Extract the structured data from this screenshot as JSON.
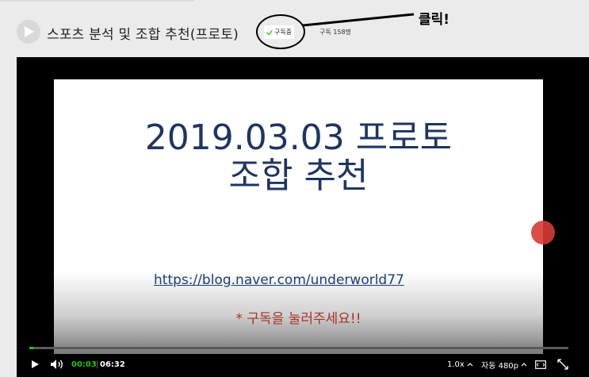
{
  "header": {
    "channel_title": "스포츠 분석 및 조합 추천(프로토)",
    "subscribe_label": "구독중",
    "subscriber_count": "구독 158명"
  },
  "annotation": {
    "text": "클릭!"
  },
  "video": {
    "slide_title_line1": "2019.03.03 프로토",
    "slide_title_line2": "조합 추천",
    "slide_link": "https://blog.naver.com/underworld77",
    "slide_cta": "* 구독을 눌러주세요!!",
    "progress": 0.008
  },
  "controls": {
    "current_time": "00:03",
    "separator": "|",
    "total_time": "06:32",
    "speed": "1.0x",
    "quality": "자동 480p"
  },
  "colors": {
    "accent": "#1ec800",
    "slide_text": "#1f3563",
    "cta_red": "#a93226",
    "annotation": "#000000"
  },
  "icons": {
    "avatar": "play-icon",
    "subscribe": "check-icon",
    "play": "play-icon",
    "volume": "volume-icon",
    "speed": "chevron-up-icon",
    "quality": "chevron-up-icon",
    "theater": "theater-mode-icon",
    "fullscreen": "fullscreen-icon"
  }
}
